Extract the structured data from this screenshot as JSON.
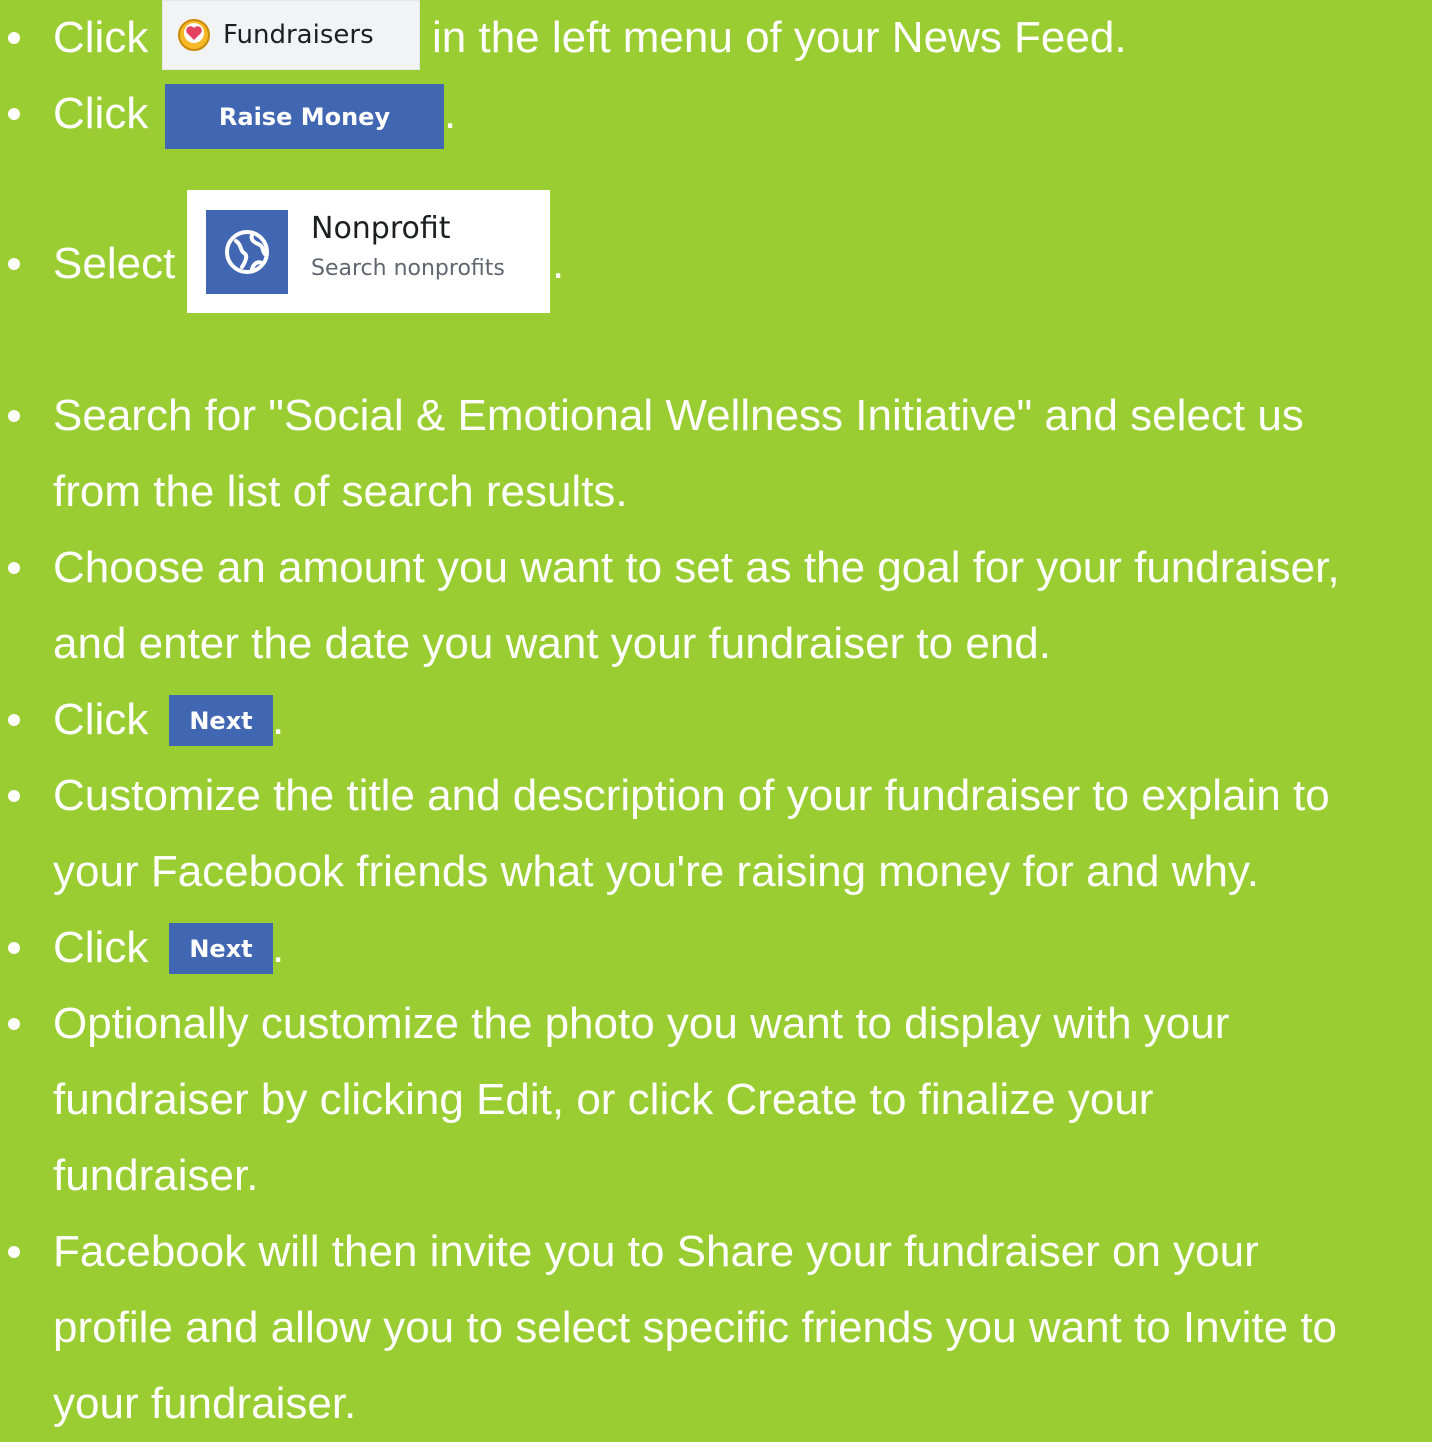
{
  "steps": {
    "s1": {
      "prefix": "Click",
      "chip_label": "Fundraisers",
      "suffix": "in the left menu of your News Feed."
    },
    "s2": {
      "prefix": "Click",
      "button_label": "Raise Money",
      "suffix": "."
    },
    "s3": {
      "prefix": "Select",
      "card_title": "Nonprofit",
      "card_subtitle": "Search nonprofits",
      "suffix": "."
    },
    "s4": {
      "line1": "Search for \"Social & Emotional Wellness Initiative\" and select us",
      "line2": "from the list of search results."
    },
    "s5": {
      "line1": "Choose an amount you want to set as the goal for your fundraiser,",
      "line2": "and enter the date you want your fundraiser to end."
    },
    "s6": {
      "prefix": "Click",
      "button_label": "Next",
      "suffix": "."
    },
    "s7": {
      "line1": "Customize the title and description of your fundraiser to explain to",
      "line2": "your Facebook friends what you're raising money for and why."
    },
    "s8": {
      "prefix": "Click",
      "button_label": "Next",
      "suffix": "."
    },
    "s9": {
      "line1": "Optionally customize the photo you want to display with your",
      "line2": "fundraiser by clicking Edit, or click Create to finalize your",
      "line3": "fundraiser."
    },
    "s10": {
      "line1": "Facebook will then invite you to Share your fundraiser on your",
      "line2": "profile and allow you to select specific friends you want to Invite to",
      "line3": "your fundraiser."
    }
  },
  "colors": {
    "background": "#9acd32",
    "text": "#ffffff",
    "facebook_blue": "#4267b2"
  },
  "icons": {
    "fundraisers": "heart-coin-icon",
    "nonprofit": "globe-icon"
  }
}
